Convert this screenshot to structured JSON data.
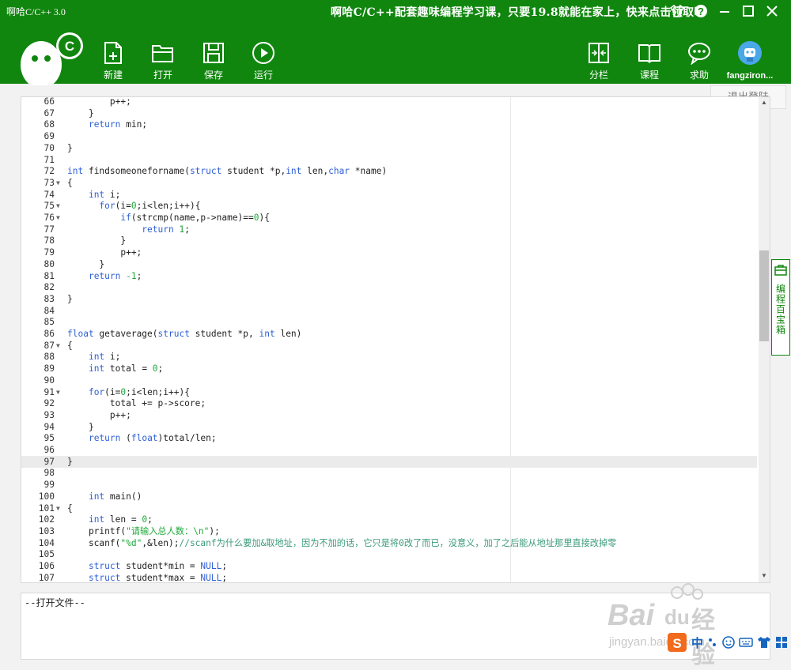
{
  "window": {
    "title": "啊哈C/C++ 3.0",
    "promo": "啊哈C/C++配套趣味编程学习课，只要19.8就能在家上，快来点击领取吧",
    "controls": [
      "shirt-icon",
      "help-icon",
      "minimize-icon",
      "maximize-icon",
      "close-icon"
    ]
  },
  "toolbar": {
    "left": [
      {
        "label": "新建",
        "icon": "new-file-icon"
      },
      {
        "label": "打开",
        "icon": "folder-open-icon"
      },
      {
        "label": "保存",
        "icon": "save-icon"
      },
      {
        "label": "运行",
        "icon": "play-icon"
      }
    ],
    "right": [
      {
        "label": "分栏",
        "icon": "split-view-icon"
      },
      {
        "label": "课程",
        "icon": "book-icon"
      },
      {
        "label": "求助",
        "icon": "chat-icon"
      }
    ],
    "user": "fangziron...",
    "logout": "退出登陆"
  },
  "side_tab": "编程百宝箱",
  "output": {
    "text": "--打开文件--"
  },
  "watermark": {
    "brand": "Bai",
    "brand2": "du",
    "brand3": "经验",
    "url": "jingyan.baidu.com"
  },
  "ime": {
    "lang": "中"
  },
  "colors": {
    "accent": "#11860f",
    "keyword": "#2e5fd6",
    "literal": "#1ea83a"
  },
  "editor": {
    "active_line": 97,
    "lines": [
      {
        "n": 66,
        "fold": false,
        "code": "        p++;"
      },
      {
        "n": 67,
        "fold": false,
        "code": "    }"
      },
      {
        "n": 68,
        "fold": false,
        "code": "    return min;"
      },
      {
        "n": 69,
        "fold": false,
        "code": ""
      },
      {
        "n": 70,
        "fold": false,
        "code": "}"
      },
      {
        "n": 71,
        "fold": false,
        "code": ""
      },
      {
        "n": 72,
        "fold": false,
        "code": "int findsomeoneforname(struct student *p,int len,char *name)"
      },
      {
        "n": 73,
        "fold": true,
        "code": "{"
      },
      {
        "n": 74,
        "fold": false,
        "code": "    int i;"
      },
      {
        "n": 75,
        "fold": true,
        "code": "      for(i=0;i<len;i++){"
      },
      {
        "n": 76,
        "fold": true,
        "code": "          if(strcmp(name,p->name)==0){"
      },
      {
        "n": 77,
        "fold": false,
        "code": "              return 1;"
      },
      {
        "n": 78,
        "fold": false,
        "code": "          }"
      },
      {
        "n": 79,
        "fold": false,
        "code": "          p++;"
      },
      {
        "n": 80,
        "fold": false,
        "code": "      }"
      },
      {
        "n": 81,
        "fold": false,
        "code": "    return -1;"
      },
      {
        "n": 82,
        "fold": false,
        "code": ""
      },
      {
        "n": 83,
        "fold": false,
        "code": "}"
      },
      {
        "n": 84,
        "fold": false,
        "code": ""
      },
      {
        "n": 85,
        "fold": false,
        "code": ""
      },
      {
        "n": 86,
        "fold": false,
        "code": "float getaverage(struct student *p, int len)"
      },
      {
        "n": 87,
        "fold": true,
        "code": "{"
      },
      {
        "n": 88,
        "fold": false,
        "code": "    int i;"
      },
      {
        "n": 89,
        "fold": false,
        "code": "    int total = 0;"
      },
      {
        "n": 90,
        "fold": false,
        "code": ""
      },
      {
        "n": 91,
        "fold": true,
        "code": "    for(i=0;i<len;i++){"
      },
      {
        "n": 92,
        "fold": false,
        "code": "        total += p->score;"
      },
      {
        "n": 93,
        "fold": false,
        "code": "        p++;"
      },
      {
        "n": 94,
        "fold": false,
        "code": "    }"
      },
      {
        "n": 95,
        "fold": false,
        "code": "    return (float)total/len;"
      },
      {
        "n": 96,
        "fold": false,
        "code": ""
      },
      {
        "n": 97,
        "fold": false,
        "code": "}"
      },
      {
        "n": 98,
        "fold": false,
        "code": ""
      },
      {
        "n": 99,
        "fold": false,
        "code": ""
      },
      {
        "n": 100,
        "fold": false,
        "code": "    int main()"
      },
      {
        "n": 101,
        "fold": true,
        "code": "{"
      },
      {
        "n": 102,
        "fold": false,
        "code": "    int len = 0;"
      },
      {
        "n": 103,
        "fold": false,
        "code": "    printf(\"请输入总人数：\\n\");"
      },
      {
        "n": 104,
        "fold": false,
        "code": "    scanf(\"%d\",&len);//scanf为什么要加&取地址，因为不加的话，它只是将0改了而已，没意义，加了之后能从地址那里直接改掉零"
      },
      {
        "n": 105,
        "fold": false,
        "code": ""
      },
      {
        "n": 106,
        "fold": false,
        "code": "    struct student*min = NULL;"
      },
      {
        "n": 107,
        "fold": false,
        "code": "    struct student*max = NULL;"
      }
    ]
  }
}
